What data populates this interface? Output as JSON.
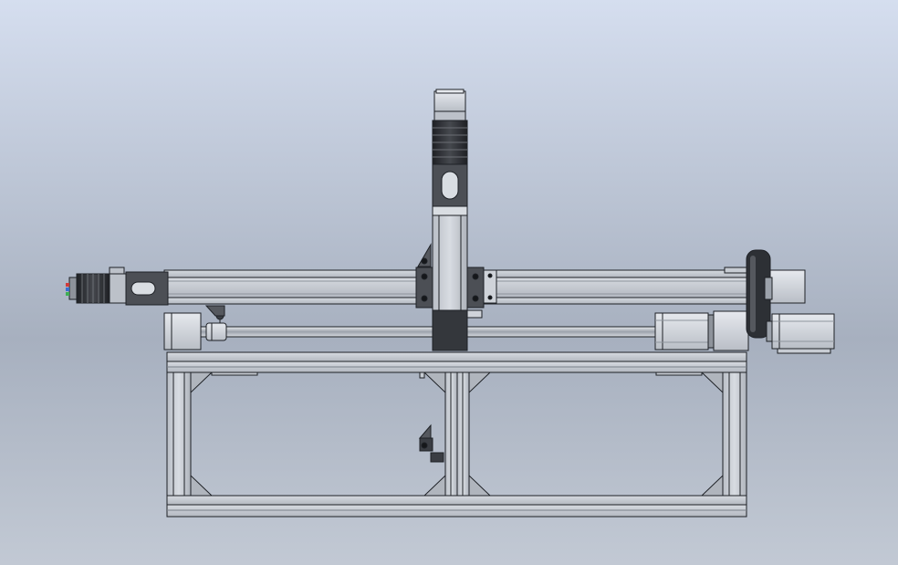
{
  "scene": {
    "kind": "cad-assembly-view",
    "subject": "gantry-frame",
    "background_top_color": "#d5deef",
    "background_mid_color": "#a7b0bf",
    "background_bottom_color": "#c2c9d4",
    "metal_color": "#c3c8d0",
    "edge_color": "#1e2126",
    "dark_part_color": "#4c4f55",
    "motor_color": "#2a2c31"
  }
}
